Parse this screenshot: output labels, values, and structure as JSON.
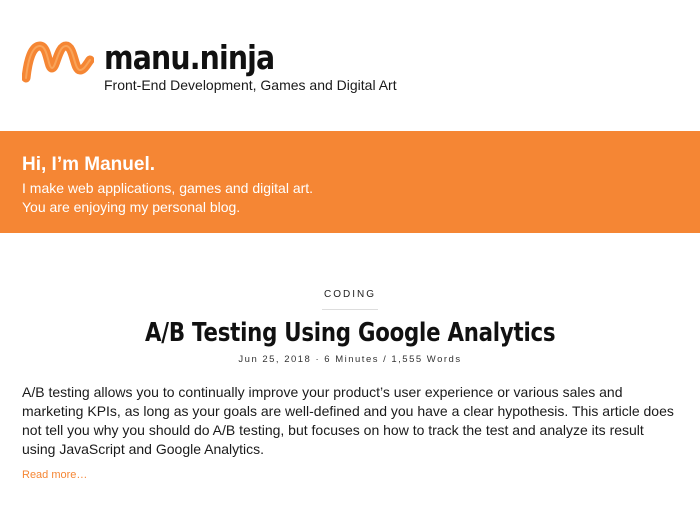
{
  "site": {
    "title": "manu.ninja",
    "tagline": "Front-End Development, Games and Digital Art",
    "logo_icon": "manu-ninja-m-logo",
    "brand_color": "#f58634"
  },
  "hero": {
    "title": "Hi, I’m Manuel.",
    "line1": "I make web applications, games and digital art.",
    "line2": "You are enjoying my personal blog."
  },
  "post": {
    "category": "CODING",
    "title": "A/B Testing Using Google Analytics",
    "meta": "Jun 25, 2018 · 6 Minutes / 1,555 Words",
    "excerpt": "A/B testing allows you to continually improve your product’s user experience or various sales and marketing KPIs, as long as your goals are well-defined and you have a clear hypothesis. This article does not tell you why you should do A/B testing, but focuses on how to track the test and analyze its result using JavaScript and Google Analytics.",
    "read_more": "Read more…"
  }
}
